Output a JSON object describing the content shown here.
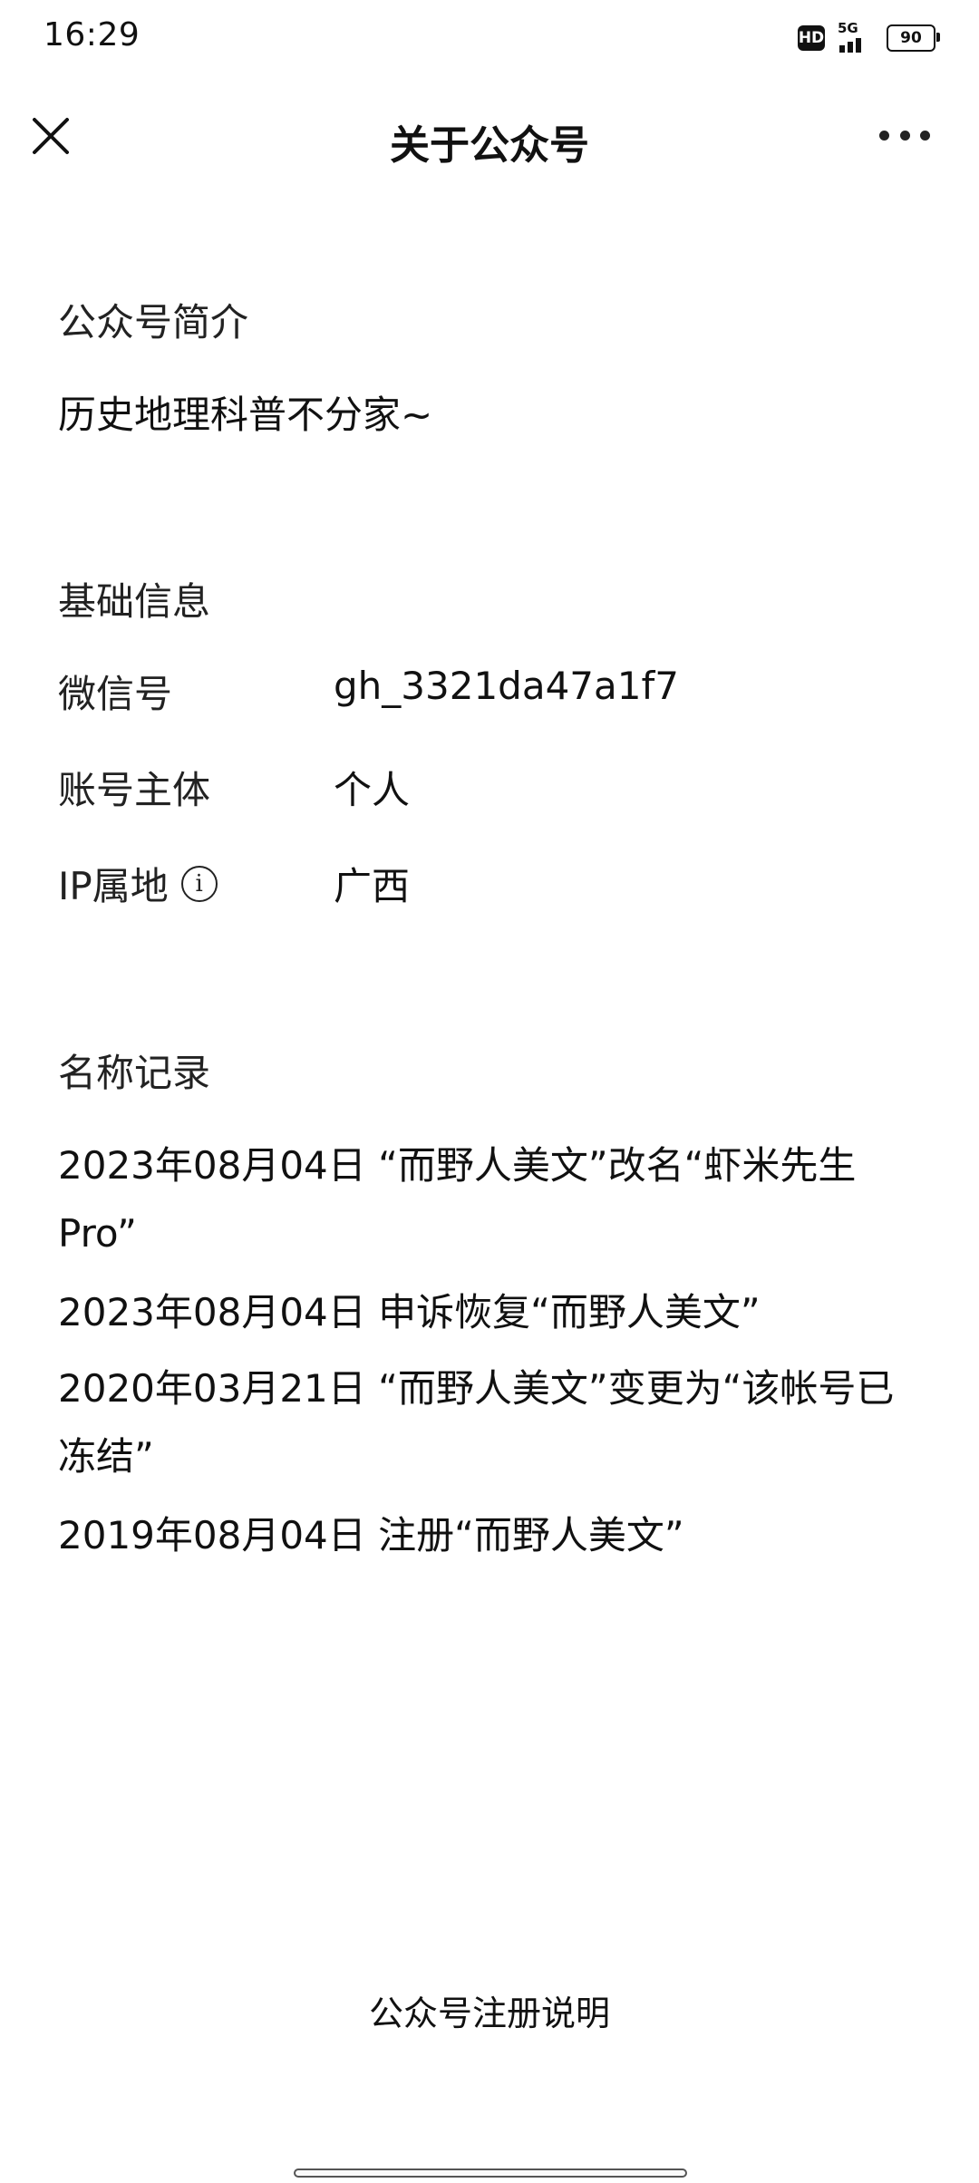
{
  "status_bar": {
    "time": "16:29",
    "network": "5G",
    "hd_label": "HD",
    "battery": "90"
  },
  "nav": {
    "title": "关于公众号"
  },
  "intro": {
    "heading": "公众号简介",
    "text": "历史地理科普不分家~"
  },
  "basic_info": {
    "heading": "基础信息",
    "rows": [
      {
        "label": "微信号",
        "value": "gh_3321da47a1f7"
      },
      {
        "label": "账号主体",
        "value": "个人"
      },
      {
        "label": "IP属地",
        "value": "广西"
      }
    ]
  },
  "name_records": {
    "heading": "名称记录",
    "items": [
      "2023年08月04日 “而野人美文”改名“虾米先生Pro”",
      "2023年08月04日 申诉恢复“而野人美文”",
      "2020年03月21日 “而野人美文”变更为“该帐号已冻结”",
      "2019年08月04日 注册“而野人美文”"
    ]
  },
  "footer": {
    "link": "公众号注册说明"
  }
}
